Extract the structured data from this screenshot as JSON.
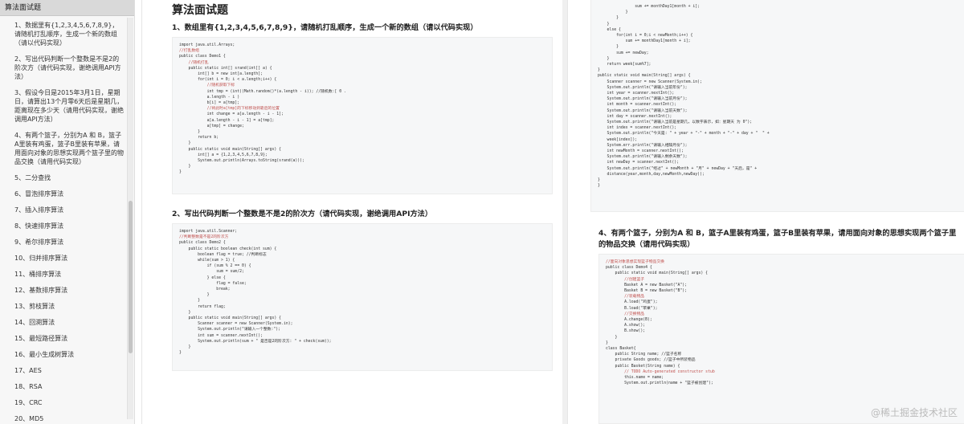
{
  "sidebar": {
    "title": "算法面试题",
    "items": [
      "1、数据里有{1,2,3,4,5,6,7,8,9}，请随机打乱顺序，生成一个新的数组（请以代码实现）",
      "2、写出代码判断一个整数是不是2的阶次方（请代码实现，谢绝调用API方法）",
      "3、假设今日是2015年3月1日，星期日，请算出13个月零6天后是星期几，距离现在多少天（请用代码实现，谢绝调用API方法）",
      "4、有两个篮子，分别为A 和 B，篮子A里装有鸡蛋，篮子B里装有苹果，请用面向对象的思想实现两个篮子里的物品交换（请用代码实现）",
      "5、二分查找",
      "6、冒泡排序算法",
      "7、插入排序算法",
      "8、快速排序算法",
      "9、希尔排序算法",
      "10、归并排序算法",
      "11、桶排序算法",
      "12、基数排序算法",
      "13、剪枝算法",
      "14、回溯算法",
      "15、最短路径算法",
      "16、最小生成树算法",
      "17、AES",
      "18、RSA",
      "19、CRC",
      "20、MD5"
    ]
  },
  "left_page": {
    "title": "算法面试题",
    "q1_heading": "1、数组里有{1,2,3,4,5,6,7,8,9}，请随机打乱顺序，生成一个新的数组（请以代码实现）",
    "q1_code": [
      "import java.util.Arrays;",
      "//打乱数组",
      "public class Demo1 {",
      "    //随机打乱",
      "    public static int[] srand(int[] a) {",
      "        int[] b = new int[a.length];",
      "        for(int i = 0; i < a.length;i++) {",
      "            //随机获取下标",
      "            int tmp = (int)(Math.random()*(a.length - i)); //随机数:[ 0 .",
      "            a.length - i )",
      "            b[i] = a[tmp];",
      "            //将此时a[tmp]的下标移动到靠后的位置",
      "            int change = a[a.length - i - 1];",
      "            a[a.length - i - 1] = a[tmp];",
      "            a[tmp] = change;",
      "        }",
      "        return b;",
      "    }",
      "    public static void main(String[] args) {",
      "        int[] a = {1,2,3,4,5,6,7,8,9};",
      "        System.out.println(Arrays.toString(srand(a)));",
      "    }",
      "}"
    ],
    "q2_heading": "2、写出代码判断一个整数是不是2的阶次方（请代码实现，谢绝调用API方法）",
    "q2_code": [
      "import java.util.Scanner;",
      "//判断整数是不是2的阶次方",
      "public class Demo2 {",
      "    public static boolean check(int sum) {",
      "        boolean flag = true; //判断标志",
      "        while(sum > 1) {",
      "            if (sum % 2 == 0) {",
      "                sum = sum/2;",
      "            } else {",
      "                flag = false;",
      "                break;",
      "            }",
      "        }",
      "        return flag;",
      "    }",
      "    public static void main(String[] args) {",
      "        Scanner scanner = new Scanner(System.in);",
      "        System.out.println(\"请输入一个整数:\");",
      "        int sum = scanner.nextInt();",
      "        System.out.println(sum + \" 是否是2的阶次方: \" + check(sum));",
      "    }",
      "}"
    ]
  },
  "right_page": {
    "q3_code": [
      "                sum += monthDay1[month + i];",
      "            }",
      "        }",
      "    }",
      "    else {",
      "        for(int i = 0;i < newMonth;i++) {",
      "            sum += monthDay1[month + i];",
      "        }",
      "        sum += newDay;",
      "    }",
      "    return week[sum%7];",
      "}",
      "public static void main(String[] args) {",
      "    Scanner scanner = new Scanner(System.in);",
      "    System.out.println(\"请输入当前年份\");",
      "    int year = scanner.nextInt();",
      "    System.out.println(\"请输入当前月份\");",
      "    int month = scanner.nextInt();",
      "    System.out.println(\"请输入当前天数\");",
      "    int day = scanner.nextInt();",
      "    System.out.println(\"请输入当前是星期几，以数字表示，如：星期天 为 0\");",
      "    int index = scanner.nextInt();",
      "    System.out.println(\"今天是: \" + year + \"-\" + month + \"-\" + day + \"  \" +",
      "    week[index]);",
      "    System.err.println(\"请输入相隔月份\");",
      "    int newMonth = scanner.nextInt();",
      "    System.out.println(\"请输入剩余天数\");",
      "    int newDay = scanner.nextInt();",
      "    System.out.println(\"经过\" + newMonth + \"月\" + newDay + \"天后，是\" +",
      "    distance(year,month,day,newMonth,newDay));",
      "}",
      "}"
    ],
    "q4_heading": "4、有两个篮子，分别为A 和 B，篮子A里装有鸡蛋，篮子B里装有苹果，请用面向对象的思想实现两个篮子里的物品交换（请用代码实现）",
    "q4_code": [
      "//面向对象思想实现篮子物品交换",
      "public class Demo4 {",
      "    public static void main(String[] args) {",
      "        //创建篮子",
      "        Basket A = new Basket(\"A\");",
      "        Basket B = new Basket(\"B\");",
      "        //装载物品",
      "        A.load(\"鸡蛋\");",
      "        B.load(\"苹果\");",
      "        //交换物品",
      "        A.change(B);",
      "        A.show();",
      "        B.show();",
      "    }",
      "}",
      "",
      "class Basket{",
      "    public String name; //篮子名称",
      "    private Goods goods; //篮子中所装物品",
      "    public Basket(String name) {",
      "        // TODO Auto-generated constructor stub",
      "        this.name = name;",
      "        System.out.println(name + \"篮子被创建\");"
    ]
  },
  "watermark": "@稀土掘金技术社区"
}
